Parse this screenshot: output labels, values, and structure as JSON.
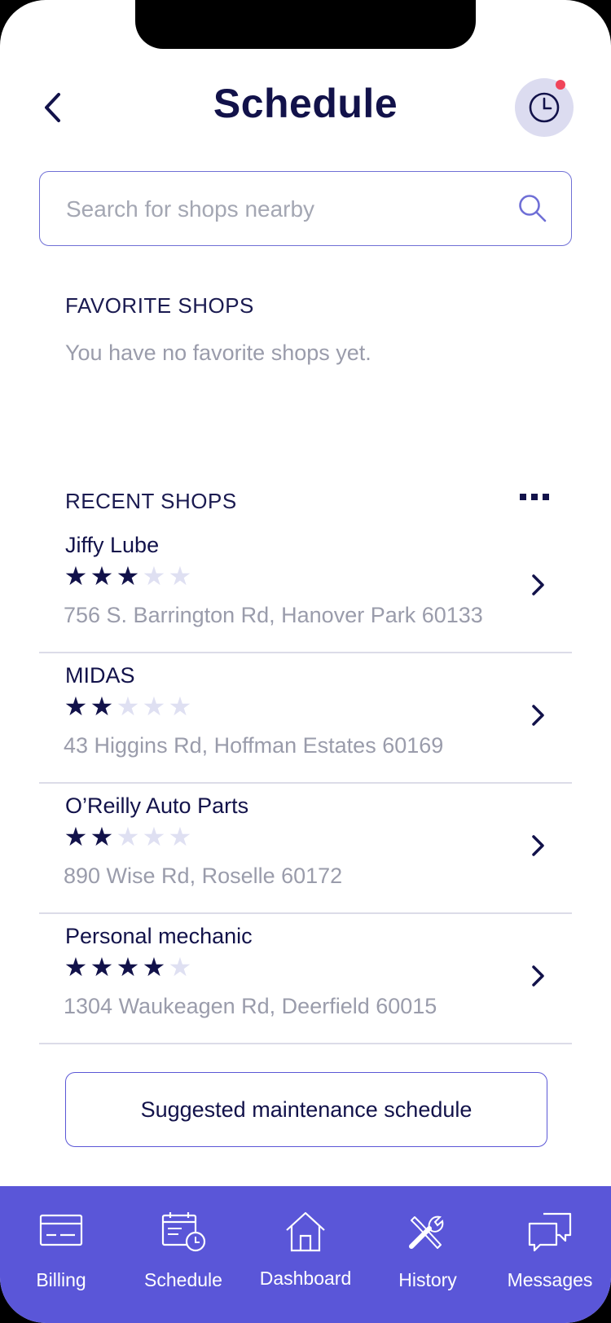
{
  "header": {
    "title": "Schedule",
    "back_icon": "chevron-left-icon",
    "history_icon": "clock-icon"
  },
  "search": {
    "placeholder": "Search for shops nearby",
    "value": "",
    "icon": "search-icon"
  },
  "favorites": {
    "heading": "FAVORITE SHOPS",
    "empty_text": "You have no favorite shops yet."
  },
  "recent": {
    "heading": "RECENT SHOPS",
    "more_icon": "more-horizontal-icon",
    "shops": [
      {
        "name": "Jiffy Lube",
        "rating": 3,
        "max_rating": 5,
        "address": "756 S. Barrington Rd, Hanover Park 60133"
      },
      {
        "name": "MIDAS",
        "rating": 2,
        "max_rating": 5,
        "address": "43 Higgins Rd, Hoffman Estates 60169"
      },
      {
        "name": "O’Reilly Auto Parts",
        "rating": 2,
        "max_rating": 5,
        "address": "890 Wise Rd, Roselle 60172"
      },
      {
        "name": "Personal mechanic",
        "rating": 4,
        "max_rating": 5,
        "address": "1304 Waukeagen Rd, Deerfield 60015"
      }
    ]
  },
  "suggest_button": {
    "label": "Suggested maintenance schedule"
  },
  "tabbar": {
    "items": [
      {
        "label": "Billing",
        "icon": "billing-card-icon"
      },
      {
        "label": "Schedule",
        "icon": "calendar-clock-icon"
      },
      {
        "label": "Dashboard",
        "icon": "home-icon"
      },
      {
        "label": "History",
        "icon": "tools-icon"
      },
      {
        "label": "Messages",
        "icon": "chat-bubbles-icon"
      }
    ]
  },
  "colors": {
    "primary_dark": "#12124a",
    "accent": "#5a56d8",
    "notification_dot": "#f0455a",
    "muted_text": "#9a9cab",
    "star_off": "#dfe0f2"
  }
}
